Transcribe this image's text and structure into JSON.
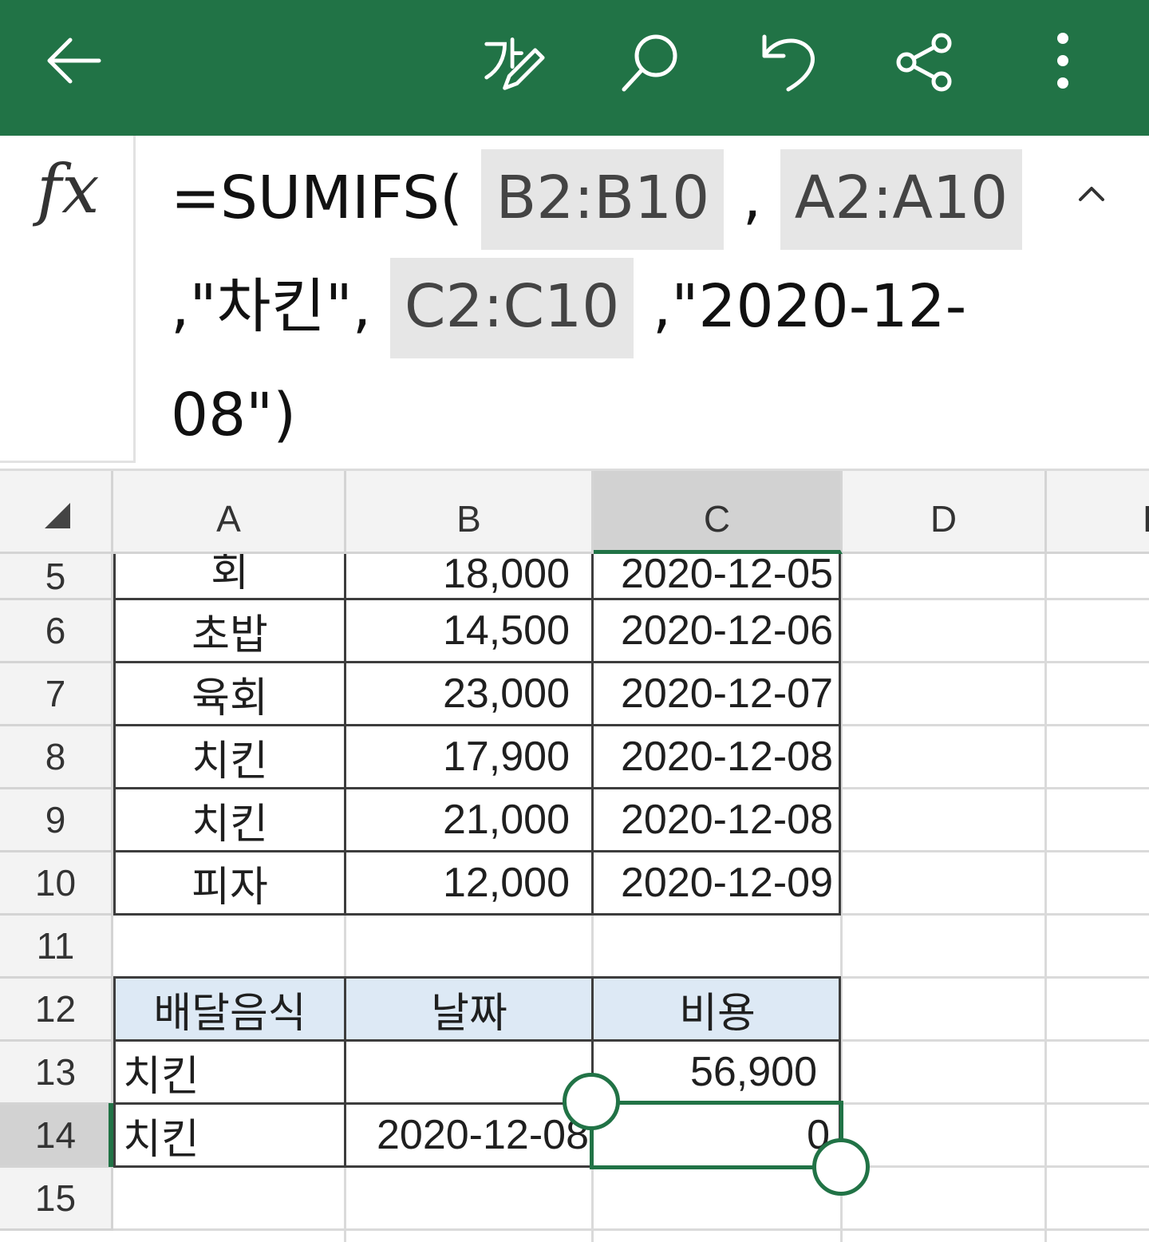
{
  "toolbar": {
    "back_icon": "arrow-left-icon",
    "edit_icon": "pen-edit-icon",
    "search_icon": "search-icon",
    "undo_icon": "undo-icon",
    "share_icon": "share-icon",
    "more_icon": "more-vertical-icon",
    "accent": "#217346"
  },
  "formula_bar": {
    "fx_label": "fx",
    "formula": {
      "p1": "=SUMIFS(",
      "ref1": "B2:B10",
      "p2": ",",
      "ref2": "A2:A10",
      "p3": ",\"차킨\",",
      "ref3": "C2:C10",
      "p4": ",\"2020-12-08\")"
    },
    "collapse_icon": "chevron-up-icon"
  },
  "sheet": {
    "columns": [
      "A",
      "B",
      "C",
      "D",
      "E"
    ],
    "selected_column": "C",
    "rows": [
      {
        "num": "5",
        "a": "회",
        "b": "18,000",
        "c": "2020-12-05"
      },
      {
        "num": "6",
        "a": "초밥",
        "b": "14,500",
        "c": "2020-12-06"
      },
      {
        "num": "7",
        "a": "육회",
        "b": "23,000",
        "c": "2020-12-07"
      },
      {
        "num": "8",
        "a": "치킨",
        "b": "17,900",
        "c": "2020-12-08"
      },
      {
        "num": "9",
        "a": "치킨",
        "b": "21,000",
        "c": "2020-12-08"
      },
      {
        "num": "10",
        "a": "피자",
        "b": "12,000",
        "c": "2020-12-09"
      },
      {
        "num": "11",
        "a": "",
        "b": "",
        "c": ""
      },
      {
        "num": "12",
        "a": "배달음식",
        "b": "날짜",
        "c": "비용"
      },
      {
        "num": "13",
        "a": "치킨",
        "b": "",
        "c": "56,900"
      },
      {
        "num": "14",
        "a": "치킨",
        "b": "2020-12-08",
        "c": "0"
      },
      {
        "num": "15",
        "a": "",
        "b": "",
        "c": ""
      }
    ],
    "selected_row": "14",
    "header_fill": "#dde9f5"
  }
}
